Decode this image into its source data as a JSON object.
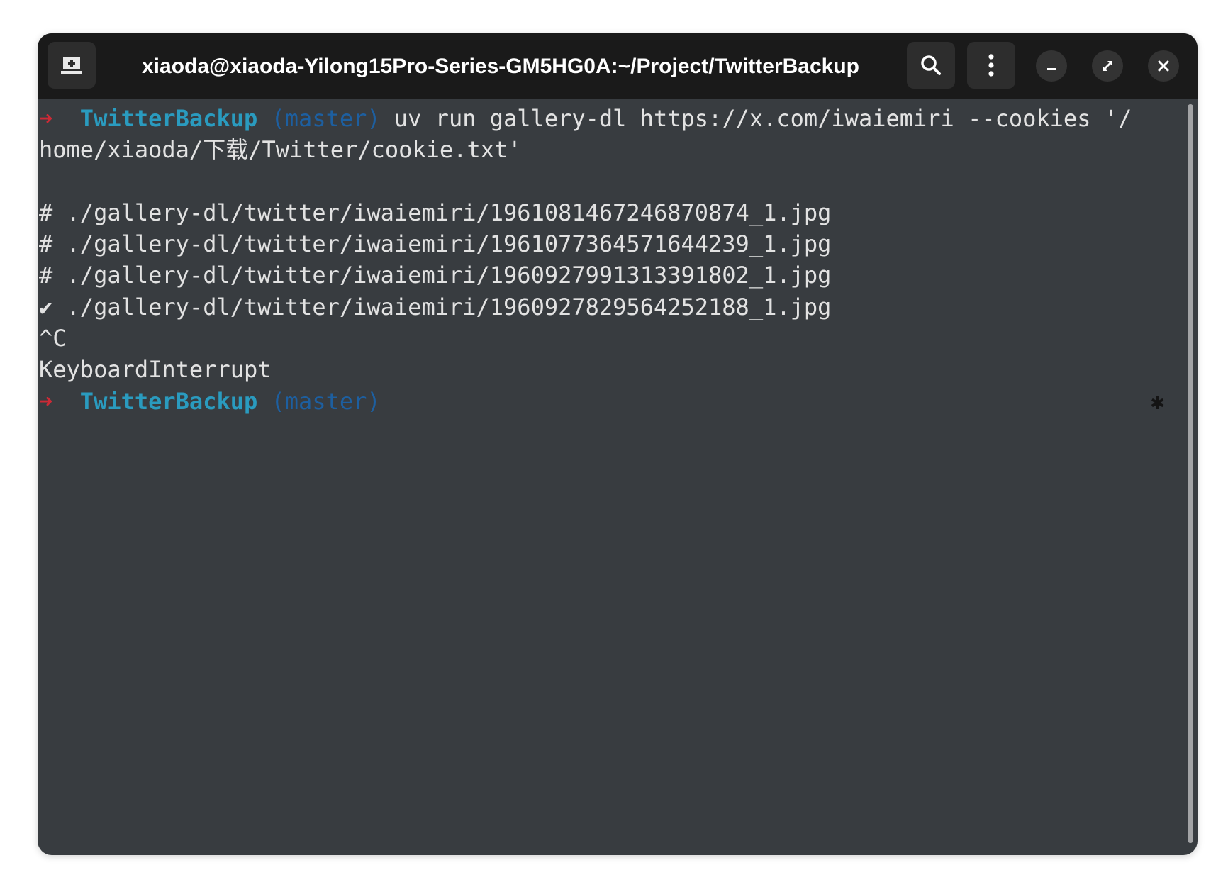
{
  "window": {
    "title": "xiaoda@xiaoda-Yilong15Pro-Series-GM5HG0A:~/Project/TwitterBackup"
  },
  "titlebar": {
    "new_tab_icon": "new-tab-icon",
    "search_icon": "search-icon",
    "menu_icon": "kebab-menu-icon",
    "minimize_icon": "minimize-icon",
    "maximize_icon": "maximize-icon",
    "close_icon": "close-icon"
  },
  "terminal": {
    "prompt_arrow": "➜",
    "prompt_dir": "TwitterBackup",
    "prompt_branch": "(master)",
    "command_part1": " uv run gallery-dl https://x.com/iwaiemiri --cookies '/",
    "command_part2": "home/xiaoda/下载/Twitter/cookie.txt'",
    "output_lines": [
      "# ./gallery-dl/twitter/iwaiemiri/1961081467246870874_1.jpg",
      "# ./gallery-dl/twitter/iwaiemiri/1961077364571644239_1.jpg",
      "# ./gallery-dl/twitter/iwaiemiri/1960927991313391802_1.jpg",
      "✔ ./gallery-dl/twitter/iwaiemiri/1960927829564252188_1.jpg",
      "^C",
      "KeyboardInterrupt"
    ],
    "right_marker": "✱"
  },
  "colors": {
    "titlebar_bg": "#1a1a1a",
    "terminal_bg": "#383c40",
    "prompt_arrow": "#cc2a36",
    "prompt_dir": "#2a9bbf",
    "prompt_branch": "#1d5fa0",
    "text": "#e2e2e2"
  }
}
